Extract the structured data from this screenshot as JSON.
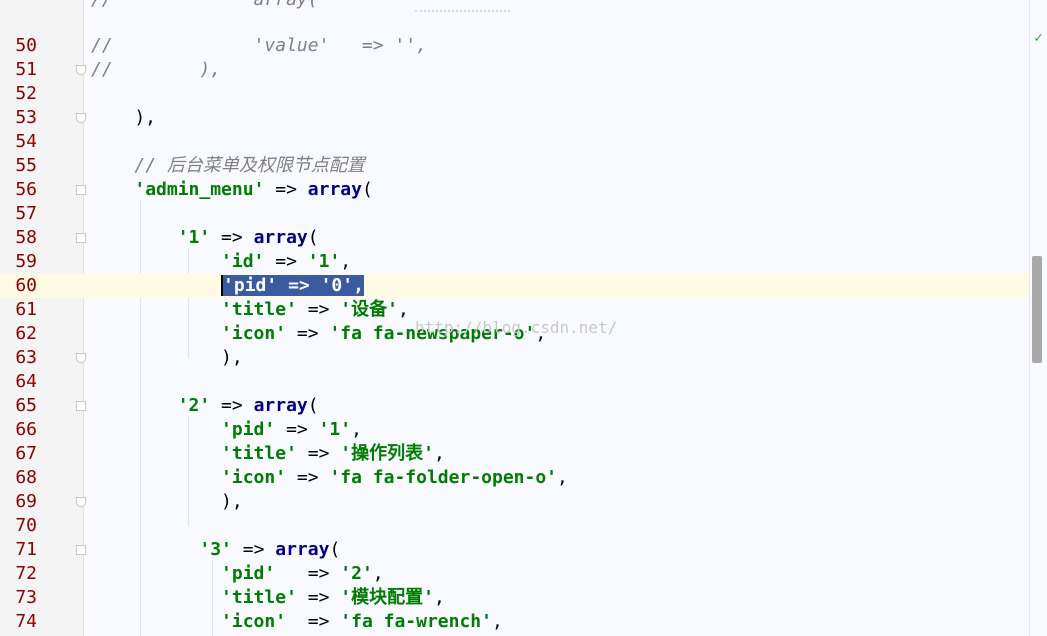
{
  "editor": {
    "top_partial_text": "//             array(",
    "watermark": "http://blog.csdn.net/",
    "status_icon": "check-icon",
    "lines": [
      {
        "num": "50",
        "fold": "",
        "tokens": [
          {
            "c": "c",
            "t": "//             'value'   => '',"
          }
        ]
      },
      {
        "num": "51",
        "fold": "end",
        "tokens": [
          {
            "c": "c",
            "t": "//        ),"
          }
        ]
      },
      {
        "num": "52",
        "fold": "",
        "tokens": []
      },
      {
        "num": "53",
        "fold": "end",
        "tokens": [
          {
            "c": "",
            "t": "    ),"
          }
        ]
      },
      {
        "num": "54",
        "fold": "",
        "tokens": []
      },
      {
        "num": "55",
        "fold": "",
        "tokens": [
          {
            "c": "",
            "t": "    "
          },
          {
            "c": "c",
            "t": "// 后台菜单及权限节点配置"
          }
        ]
      },
      {
        "num": "56",
        "fold": "start",
        "tokens": [
          {
            "c": "",
            "t": "    "
          },
          {
            "c": "s",
            "t": "'admin_menu'"
          },
          {
            "c": "",
            " t": ""
          },
          {
            "c": "",
            "t": " => "
          },
          {
            "c": "k",
            "t": "array"
          },
          {
            "c": "",
            "t": "("
          }
        ]
      },
      {
        "num": "57",
        "fold": "",
        "tokens": []
      },
      {
        "num": "58",
        "fold": "start",
        "tokens": [
          {
            "c": "",
            "t": "        "
          },
          {
            "c": "s",
            "t": "'1'"
          },
          {
            "c": "",
            "t": " => "
          },
          {
            "c": "k",
            "t": "array"
          },
          {
            "c": "",
            "t": "("
          }
        ]
      },
      {
        "num": "59",
        "fold": "",
        "tokens": [
          {
            "c": "",
            "t": "            "
          },
          {
            "c": "s",
            "t": "'id'"
          },
          {
            "c": "",
            "t": " => "
          },
          {
            "c": "s",
            "t": "'1'"
          },
          {
            "c": "",
            "t": ","
          }
        ]
      },
      {
        "num": "60",
        "fold": "",
        "current": true,
        "tokens": [
          {
            "c": "",
            "t": "            "
          },
          {
            "c": "sel caret",
            "t": "'pid' => '0',"
          }
        ]
      },
      {
        "num": "61",
        "fold": "",
        "tokens": [
          {
            "c": "",
            "t": "            "
          },
          {
            "c": "s",
            "t": "'title'"
          },
          {
            "c": "",
            "t": " => "
          },
          {
            "c": "s",
            "t": "'设备'"
          },
          {
            "c": "",
            "t": ","
          }
        ]
      },
      {
        "num": "62",
        "fold": "",
        "tokens": [
          {
            "c": "",
            "t": "            "
          },
          {
            "c": "s",
            "t": "'icon'"
          },
          {
            "c": "",
            "t": " => "
          },
          {
            "c": "s",
            "t": "'fa fa-newspaper-o'"
          },
          {
            "c": "",
            "t": ","
          }
        ]
      },
      {
        "num": "63",
        "fold": "end",
        "tokens": [
          {
            "c": "",
            "t": "            ),"
          }
        ]
      },
      {
        "num": "64",
        "fold": "",
        "tokens": []
      },
      {
        "num": "65",
        "fold": "start",
        "tokens": [
          {
            "c": "",
            "t": "        "
          },
          {
            "c": "s",
            "t": "'2'"
          },
          {
            "c": "",
            "t": " => "
          },
          {
            "c": "k",
            "t": "array"
          },
          {
            "c": "",
            "t": "("
          }
        ]
      },
      {
        "num": "66",
        "fold": "",
        "tokens": [
          {
            "c": "",
            "t": "            "
          },
          {
            "c": "s",
            "t": "'pid'"
          },
          {
            "c": "",
            "t": " => "
          },
          {
            "c": "s",
            "t": "'1'"
          },
          {
            "c": "",
            "t": ","
          }
        ]
      },
      {
        "num": "67",
        "fold": "",
        "tokens": [
          {
            "c": "",
            "t": "            "
          },
          {
            "c": "s",
            "t": "'title'"
          },
          {
            "c": "",
            "t": " => "
          },
          {
            "c": "s",
            "t": "'操作列表'"
          },
          {
            "c": "",
            "t": ","
          }
        ]
      },
      {
        "num": "68",
        "fold": "",
        "tokens": [
          {
            "c": "",
            "t": "            "
          },
          {
            "c": "s",
            "t": "'icon'"
          },
          {
            "c": "",
            "t": " => "
          },
          {
            "c": "s",
            "t": "'fa fa-folder-open-o'"
          },
          {
            "c": "",
            "t": ","
          }
        ]
      },
      {
        "num": "69",
        "fold": "end",
        "tokens": [
          {
            "c": "",
            "t": "            ),"
          }
        ]
      },
      {
        "num": "70",
        "fold": "",
        "tokens": []
      },
      {
        "num": "71",
        "fold": "start",
        "tokens": [
          {
            "c": "",
            "t": "          "
          },
          {
            "c": "s",
            "t": "'3'"
          },
          {
            "c": "",
            "t": " => "
          },
          {
            "c": "k",
            "t": "array"
          },
          {
            "c": "",
            "t": "("
          }
        ]
      },
      {
        "num": "72",
        "fold": "",
        "tokens": [
          {
            "c": "",
            "t": "            "
          },
          {
            "c": "s",
            "t": "'pid'"
          },
          {
            "c": "",
            "t": "   => "
          },
          {
            "c": "s",
            "t": "'2'"
          },
          {
            "c": "",
            "t": ","
          }
        ]
      },
      {
        "num": "73",
        "fold": "",
        "tokens": [
          {
            "c": "",
            "t": "            "
          },
          {
            "c": "s",
            "t": "'title'"
          },
          {
            "c": "",
            "t": " => "
          },
          {
            "c": "s",
            "t": "'模块配置'"
          },
          {
            "c": "",
            "t": ","
          }
        ]
      },
      {
        "num": "74",
        "fold": "",
        "tokens": [
          {
            "c": "",
            "t": "            "
          },
          {
            "c": "s",
            "t": "'icon'"
          },
          {
            "c": "",
            "t": "  => "
          },
          {
            "c": "s",
            "t": "'fa fa-wrench'"
          },
          {
            "c": "",
            "t": ","
          }
        ]
      }
    ]
  }
}
